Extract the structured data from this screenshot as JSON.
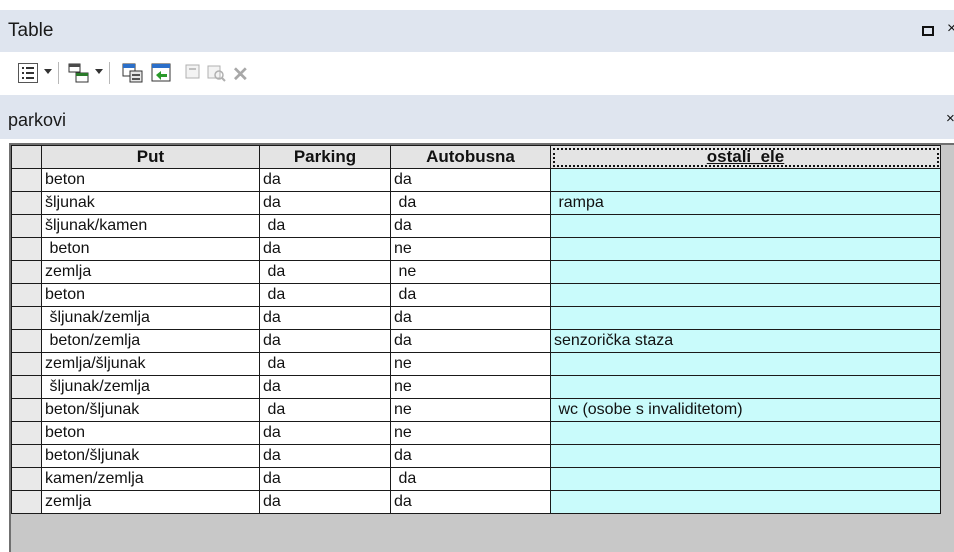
{
  "window": {
    "title": "Table",
    "close_glyph": "×"
  },
  "toolbar": {
    "buttons": [
      {
        "icon": "table-options-icon",
        "has_dropdown": true
      },
      {
        "icon": "related-tables-icon",
        "has_dropdown": true
      },
      {
        "icon": "select-by-attributes-icon",
        "has_dropdown": false
      },
      {
        "icon": "switch-selection-icon",
        "has_dropdown": false
      },
      {
        "icon": "clear-selection-icon",
        "has_dropdown": false,
        "disabled": true
      },
      {
        "icon": "zoom-to-selected-icon",
        "has_dropdown": false,
        "disabled": true
      },
      {
        "icon": "delete-selected-icon",
        "has_dropdown": false,
        "disabled": true
      }
    ],
    "delete_glyph": "✕"
  },
  "tab": {
    "label": "parkovi",
    "close_glyph": "×"
  },
  "table": {
    "columns": [
      "Put",
      "Parking",
      "Autobusna",
      "ostali_ele"
    ],
    "rows": [
      [
        "beton",
        "da",
        "da",
        ""
      ],
      [
        "šljunak",
        "da",
        " da",
        " rampa"
      ],
      [
        "šljunak/kamen",
        " da",
        "da",
        ""
      ],
      [
        " beton",
        "da",
        "ne",
        ""
      ],
      [
        "zemlja",
        " da",
        " ne",
        ""
      ],
      [
        "beton",
        " da",
        " da",
        ""
      ],
      [
        " šljunak/zemlja",
        "da",
        "da",
        ""
      ],
      [
        " beton/zemlja",
        "da",
        "da",
        "senzorička staza"
      ],
      [
        "zemlja/šljunak",
        " da",
        "ne",
        ""
      ],
      [
        " šljunak/zemlja",
        "da",
        "ne",
        ""
      ],
      [
        "beton/šljunak",
        " da",
        "ne",
        " wc (osobe s invaliditetom)"
      ],
      [
        "beton",
        "da",
        "ne",
        ""
      ],
      [
        "beton/šljunak",
        "da",
        "da",
        ""
      ],
      [
        "kamen/zemlja",
        "da",
        " da",
        ""
      ],
      [
        "zemlja",
        "da",
        "da",
        ""
      ]
    ]
  },
  "colors": {
    "header_band": "#dfe5ef",
    "highlight_column": "#c9fbfb",
    "grid_background": "#c8c8c8"
  }
}
